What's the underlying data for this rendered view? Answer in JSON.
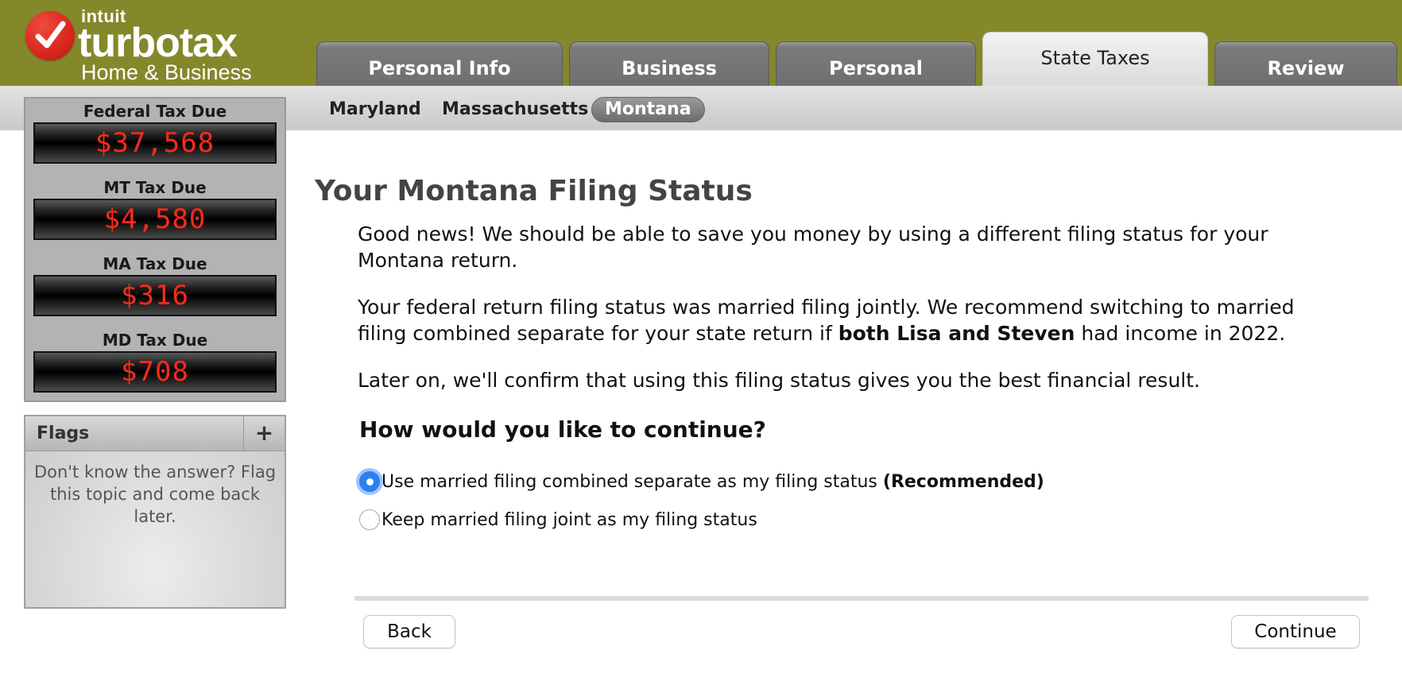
{
  "brand": {
    "company": "intuit",
    "product": "turbotax",
    "edition": "Home & Business"
  },
  "tabs": [
    {
      "label": "Personal Info",
      "active": false
    },
    {
      "label": "Business",
      "active": false
    },
    {
      "label": "Personal",
      "active": false
    },
    {
      "label": "State Taxes",
      "active": true
    },
    {
      "label": "Review",
      "active": false
    }
  ],
  "states": [
    {
      "label": "Maryland",
      "active": false
    },
    {
      "label": "Massachusetts",
      "active": false
    },
    {
      "label": "Montana",
      "active": true
    }
  ],
  "summary": [
    {
      "label": "Federal Tax Due",
      "value": "$37,568"
    },
    {
      "label": "MT Tax Due",
      "value": "$4,580"
    },
    {
      "label": "MA Tax Due",
      "value": "$316"
    },
    {
      "label": "MD Tax Due",
      "value": "$708"
    }
  ],
  "flags": {
    "title": "Flags",
    "add": "+",
    "hint": "Don't know the answer? Flag this topic and come back later."
  },
  "main": {
    "title": "Your Montana Filing Status",
    "intro": "Good news! We should be able to save you money by using a different filing status for your Montana return.",
    "recommend_before": "Your federal return filing status was married filing jointly. We recommend switching to married filing combined separate for your state return if ",
    "recommend_bold": "both Lisa and Steven",
    "recommend_after": " had income in 2022.",
    "confirm": "Later on, we'll confirm that using this filing status gives you the best financial result.",
    "question": "How would you like to continue?",
    "options": [
      {
        "label": "Use married filing combined separate as my filing status ",
        "note": "(Recommended)",
        "checked": true
      },
      {
        "label": "Keep married filing joint as my filing status",
        "note": "",
        "checked": false
      }
    ]
  },
  "nav": {
    "back": "Back",
    "continue": "Continue"
  },
  "colors": {
    "header": "#84882b",
    "tax_due_red": "#ff2a1a",
    "radio_selected": "#2f7ef0"
  }
}
